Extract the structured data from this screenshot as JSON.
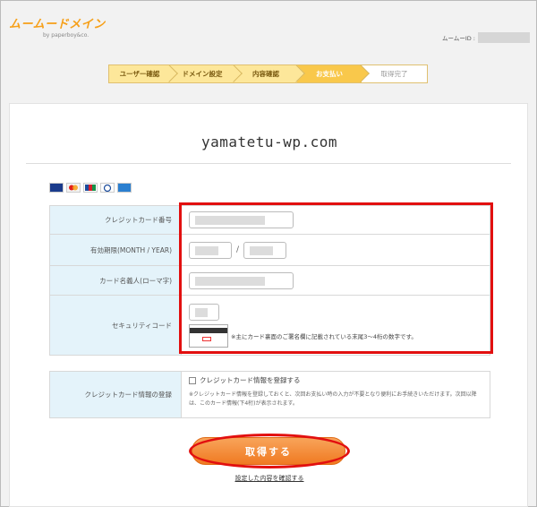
{
  "header": {
    "logo_text": "ムームードメイン",
    "logo_sub": "by paperboy&co.",
    "user_id_label": "ムームーID :"
  },
  "steps": [
    {
      "label": "ユーザー確認",
      "state": "done"
    },
    {
      "label": "ドメイン設定",
      "state": "done"
    },
    {
      "label": "内容確認",
      "state": "done"
    },
    {
      "label": "お支払い",
      "state": "current"
    },
    {
      "label": "取得完了",
      "state": "todo"
    }
  ],
  "domain": "yamatetu-wp.com",
  "form": {
    "card_number_label": "クレジットカード番号",
    "expiry_label": "有効期限(MONTH / YEAR)",
    "expiry_separator": "/",
    "holder_label": "カード名義人(ローマ字)",
    "security_label": "セキュリティコード",
    "security_note": "※主にカード裏面のご署名欄に記載されている末尾3〜4桁の数字です。"
  },
  "save_card": {
    "label": "クレジットカード情報の登録",
    "checkbox_label": "クレジットカード情報を登録する",
    "note": "※クレジットカード情報を登録しておくと、次回お支払い時の入力が不要となり便利にお手続きいただけます。次回以降は、このカード情報(下4桁)が表示されます。"
  },
  "submit_label": "取得する",
  "confirm_link": "設定した内容を確認する",
  "colors": {
    "accent": "#f07a22",
    "highlight": "#e20f0f",
    "label_bg": "#e4f3fa"
  }
}
